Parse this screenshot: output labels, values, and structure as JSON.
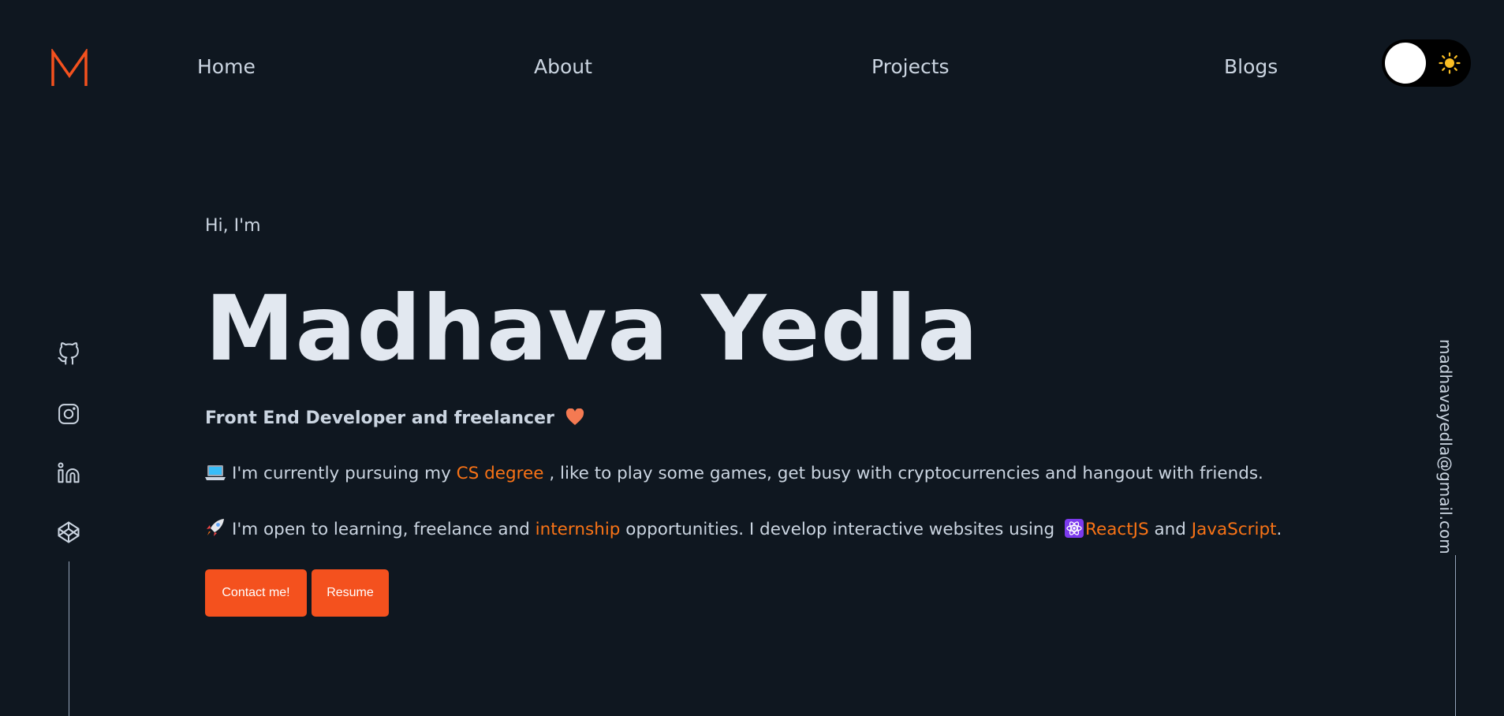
{
  "logo": {
    "letter": "M",
    "color": "#f4511e",
    "icon": "m-logo-icon"
  },
  "nav": {
    "items": [
      {
        "label": "Home"
      },
      {
        "label": "About"
      },
      {
        "label": "Projects"
      },
      {
        "label": "Blogs"
      }
    ]
  },
  "theme_toggle": {
    "state": "dark",
    "icon": "sun-icon"
  },
  "social": {
    "icons": [
      "github-icon",
      "instagram-icon",
      "linkedin-icon",
      "codepen-icon"
    ]
  },
  "email": "madhavayedla@gmail.com",
  "hero": {
    "greeting": "Hi, I'm",
    "name": "Madhava Yedla",
    "role": "Front End Developer and freelancer",
    "para1": {
      "before": "I'm currently pursuing my ",
      "link": "CS degree",
      "after": " , like to play some games, get busy with cryptocurrencies and hangout with friends."
    },
    "para2": {
      "before": "I'm open to learning, freelance and ",
      "link1": "internship",
      "middle": " opportunities. I develop interactive websites using ",
      "link2": "ReactJS",
      "and": " and ",
      "link3": "JavaScript",
      "end": "."
    },
    "buttons": {
      "contact": "Contact me!",
      "resume": "Resume"
    }
  },
  "colors": {
    "background": "#0f1720",
    "accent": "#f97316",
    "button": "#f4511e",
    "text": "#cbd5e1",
    "heading": "#e2e8f0"
  }
}
